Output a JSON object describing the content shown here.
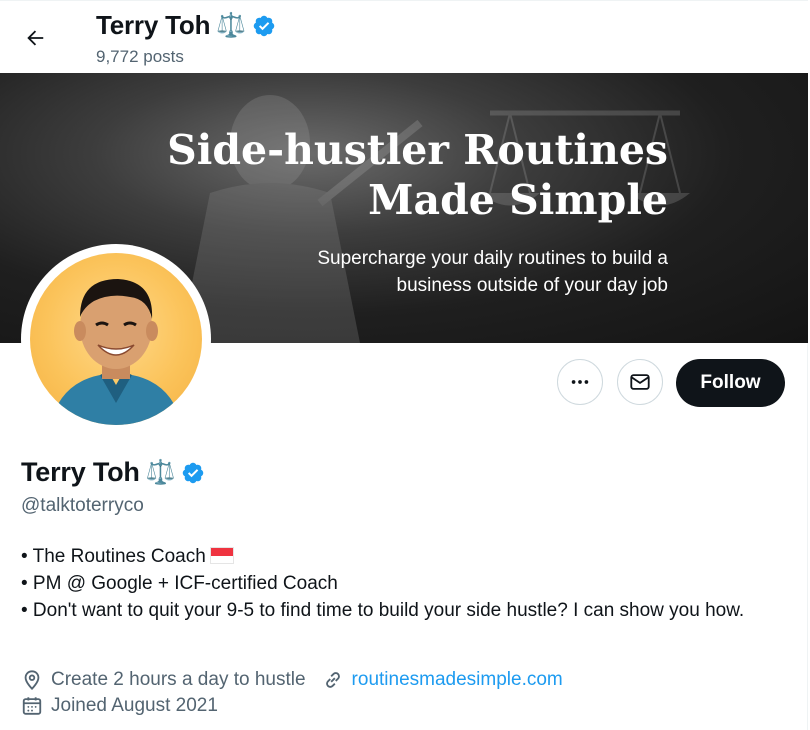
{
  "header": {
    "name": "Terry Toh",
    "name_emoji": "⚖️",
    "posts": "9,772 posts"
  },
  "banner": {
    "title_line1": "Side-hustler Routines",
    "title_line2": "Made Simple",
    "subtitle_line1": "Supercharge your daily routines to build a",
    "subtitle_line2": "business outside of your day job"
  },
  "actions": {
    "follow_label": "Follow"
  },
  "profile": {
    "name": "Terry Toh",
    "name_emoji": "⚖️",
    "handle": "@talktoterryco",
    "bio": [
      "• The Routines Coach",
      "• PM @ Google + ICF-certified Coach",
      "• Don't want to quit your 9-5 to find time to build your side hustle? I can show you how."
    ],
    "location": "Create 2 hours a day to hustle",
    "website": "routinesmadesimple.com",
    "joined": "Joined August 2021"
  },
  "colors": {
    "accent": "#1d9bf0",
    "text": "#0f1419",
    "secondary": "#536471",
    "verified": "#1d9bf0"
  },
  "icons": {
    "back": "arrow-left-icon",
    "verified": "verified-badge-icon",
    "more": "ellipsis-icon",
    "message": "envelope-icon",
    "location": "location-pin-icon",
    "link": "link-icon",
    "calendar": "calendar-icon",
    "flag": "singapore-flag-icon"
  }
}
